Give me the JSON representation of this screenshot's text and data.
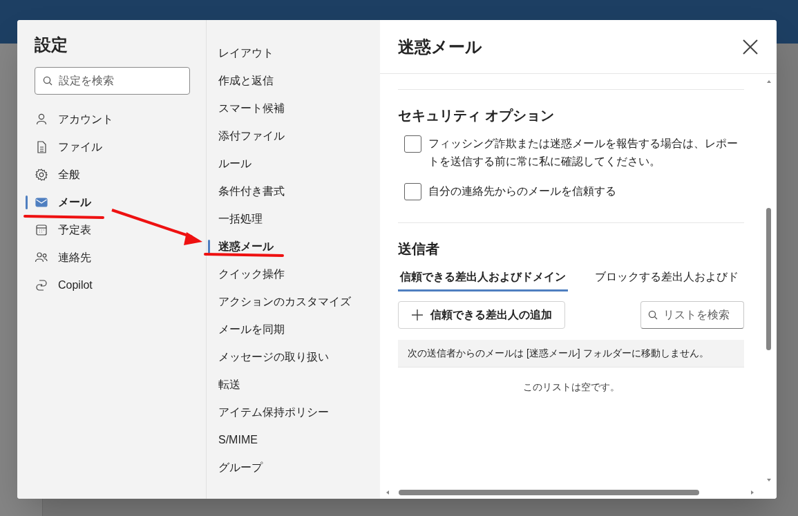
{
  "settings": {
    "title": "設定",
    "search": {
      "placeholder": "設定を検索"
    },
    "categories": [
      {
        "label": "アカウント",
        "selected": false
      },
      {
        "label": "ファイル",
        "selected": false
      },
      {
        "label": "全般",
        "selected": false
      },
      {
        "label": "メール",
        "selected": true
      },
      {
        "label": "予定表",
        "selected": false
      },
      {
        "label": "連絡先",
        "selected": false
      },
      {
        "label": "Copilot",
        "selected": false
      }
    ],
    "subcategories": [
      {
        "label": "レイアウト",
        "selected": false
      },
      {
        "label": "作成と返信",
        "selected": false
      },
      {
        "label": "スマート候補",
        "selected": false
      },
      {
        "label": "添付ファイル",
        "selected": false
      },
      {
        "label": "ルール",
        "selected": false
      },
      {
        "label": "条件付き書式",
        "selected": false
      },
      {
        "label": "一括処理",
        "selected": false
      },
      {
        "label": "迷惑メール",
        "selected": true
      },
      {
        "label": "クイック操作",
        "selected": false
      },
      {
        "label": "アクションのカスタマイズ",
        "selected": false
      },
      {
        "label": "メールを同期",
        "selected": false
      },
      {
        "label": "メッセージの取り扱い",
        "selected": false
      },
      {
        "label": "転送",
        "selected": false
      },
      {
        "label": "アイテム保持ポリシー",
        "selected": false
      },
      {
        "label": "S/MIME",
        "selected": false
      },
      {
        "label": "グループ",
        "selected": false
      }
    ]
  },
  "panel": {
    "title": "迷惑メール",
    "security": {
      "title": "セキュリティ オプション",
      "options": [
        {
          "label": "フィッシング詐欺または迷惑メールを報告する場合は、レポートを送信する前に常に私に確認してください。",
          "checked": false
        },
        {
          "label": "自分の連絡先からのメールを信頼する",
          "checked": false
        }
      ]
    },
    "senders": {
      "title": "送信者",
      "tabs": [
        {
          "label": "信頼できる差出人およびドメイン",
          "selected": true
        },
        {
          "label": "ブロックする差出人およびド",
          "selected": false
        }
      ],
      "add_button": "信頼できる差出人の追加",
      "list_search": {
        "placeholder": "リストを検索"
      },
      "notice": "次の送信者からのメールは [迷惑メール] フォルダーに移動しません。",
      "empty_message": "このリストは空です。"
    }
  }
}
